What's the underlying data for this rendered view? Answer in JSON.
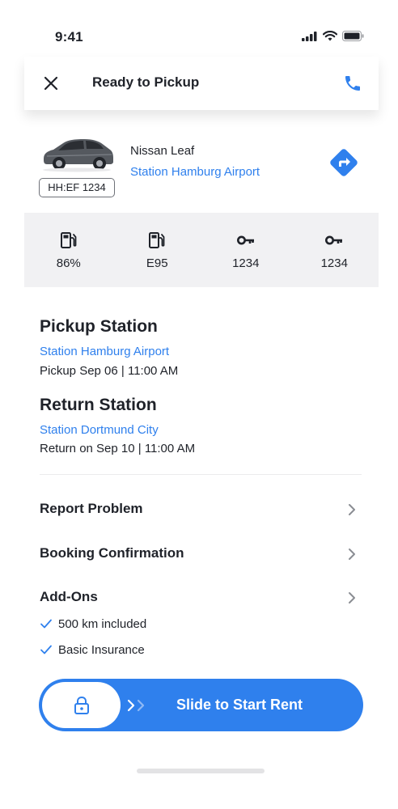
{
  "status_bar": {
    "time": "9:41"
  },
  "header": {
    "title": "Ready to Pickup"
  },
  "car": {
    "name": "Nissan Leaf",
    "station": "Station Hamburg Airport",
    "plate": "HH:EF 1234"
  },
  "stats": [
    {
      "icon": "fuel-pump-icon",
      "value": "86%"
    },
    {
      "icon": "fuel-pump-icon",
      "value": "E95"
    },
    {
      "icon": "key-icon",
      "value": "1234"
    },
    {
      "icon": "key-icon",
      "value": "1234"
    }
  ],
  "pickup": {
    "title": "Pickup Station",
    "station": "Station Hamburg Airport",
    "time": "Pickup Sep 06 | 11:00 AM"
  },
  "return": {
    "title": "Return Station",
    "station": "Station Dortmund City",
    "time": "Return on Sep 10 | 11:00 AM"
  },
  "menu": {
    "report": "Report Problem",
    "booking": "Booking Confirmation",
    "addons": "Add-Ons"
  },
  "addons": [
    "500 km included",
    "Basic Insurance"
  ],
  "slider": {
    "label": "Slide to Start Rent"
  },
  "colors": {
    "accent": "#2f80ed",
    "text": "#1f2229",
    "stats_bg": "#f1f1f3"
  }
}
